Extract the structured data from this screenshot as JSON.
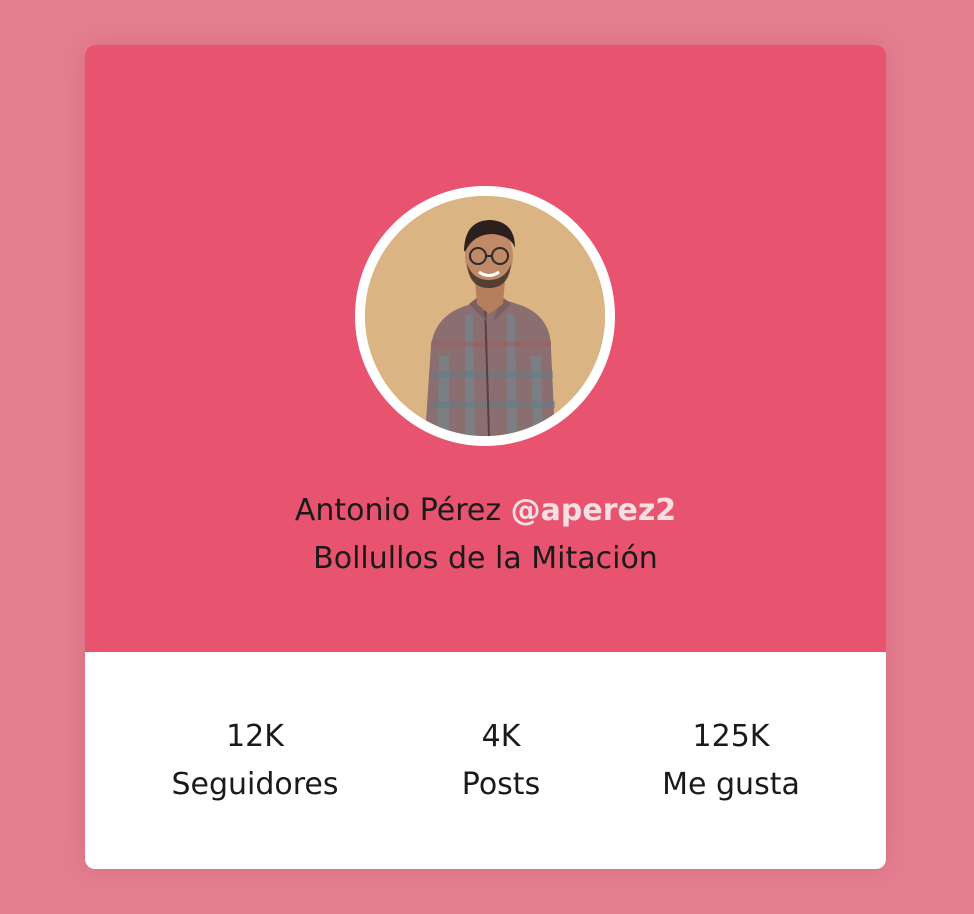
{
  "profile": {
    "name": "Antonio Pérez",
    "handle": "@aperez2",
    "location": "Bollullos de la Mitación",
    "avatar_alt": "profile photo"
  },
  "stats": [
    {
      "value": "12K",
      "label": "Seguidores"
    },
    {
      "value": "4K",
      "label": "Posts"
    },
    {
      "value": "125K",
      "label": "Me gusta"
    }
  ],
  "colors": {
    "page_background": "#e47f91",
    "header_background": "#e8546f",
    "handle_text": "#f6dfe3",
    "card_background": "#ffffff",
    "text": "#1a1a1a"
  }
}
